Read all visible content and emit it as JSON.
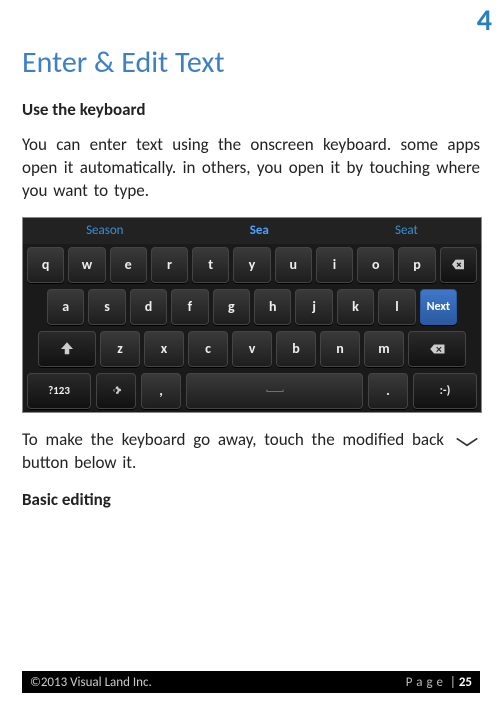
{
  "chapter_number": "4",
  "title": "Enter & Edit Text",
  "heading1": "Use the keyboard",
  "para1": "You can enter text using the onscreen keyboard. some apps open it automatically. in others, you open it by touching where you want to type.",
  "keyboard": {
    "suggestions": {
      "left": "Season",
      "mid": "Sea",
      "right": "Seat"
    },
    "row1": [
      "q",
      "w",
      "e",
      "r",
      "t",
      "y",
      "u",
      "i",
      "o",
      "p"
    ],
    "row2": [
      "a",
      "s",
      "d",
      "f",
      "g",
      "h",
      "j",
      "k",
      "l"
    ],
    "row3_shift": "⇧",
    "row3": [
      "z",
      "x",
      "c",
      "v",
      "b",
      "n",
      "m"
    ],
    "next": "Next",
    "row4": {
      "sym": "?123",
      "comma": ",",
      "space": "",
      "dot": ".",
      "smile": ":-)"
    }
  },
  "para2": "To make the keyboard go away, touch the modified back button below it.",
  "heading2": "Basic editing",
  "footer": {
    "copyright": "©2013 Visual Land Inc.",
    "page_label": "Page",
    "page_sep": " | ",
    "page_num": "25"
  }
}
